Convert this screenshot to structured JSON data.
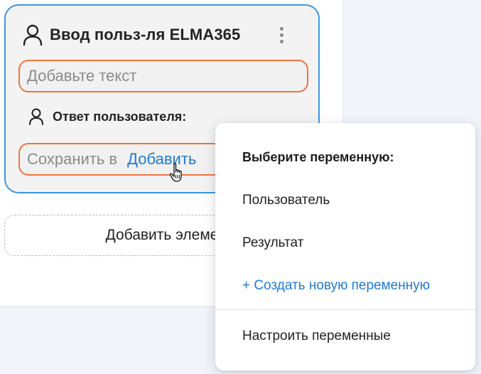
{
  "block": {
    "title": "Ввод польз-ля ELMA365",
    "text_input_placeholder": "Добавьте текст",
    "answer_label": "Ответ пользователя:",
    "save_prefix": "Сохранить в",
    "save_add_link": "Добавить"
  },
  "add_element_button": "Добавить элеме",
  "dropdown": {
    "heading": "Выберите переменную:",
    "items": [
      {
        "label": "Пользователь"
      },
      {
        "label": "Результат"
      },
      {
        "label": "+ Создать новую переменную"
      },
      {
        "label": "Настроить переменные"
      }
    ]
  },
  "icons": {
    "header_icon": "person-icon",
    "answer_icon": "person-icon",
    "menu_icon": "kebab-menu-icon",
    "cursor": "hand-pointer-cursor"
  },
  "colors": {
    "card_border": "#3b95e8",
    "input_border": "#f07440",
    "link": "#1e7bd6",
    "background": "#f2f4fa"
  }
}
